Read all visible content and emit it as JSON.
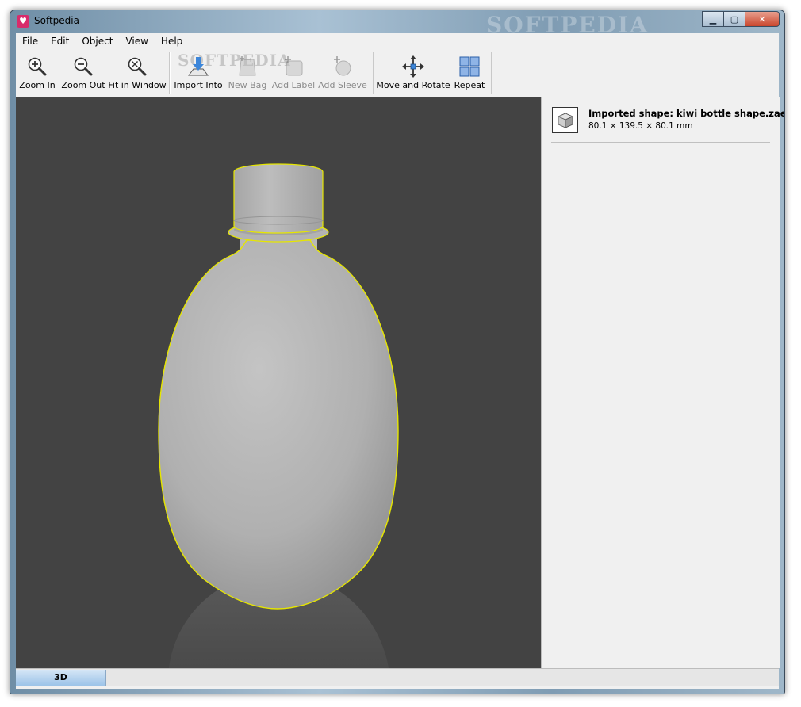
{
  "window": {
    "title": "Softpedia",
    "title_watermark": "SOFTPEDIA",
    "minimize_label": "▁",
    "maximize_label": "▢",
    "close_label": "✕"
  },
  "menu": {
    "items": [
      "File",
      "Edit",
      "Object",
      "View",
      "Help"
    ]
  },
  "toolbar": {
    "watermark": "SOFTPEDIA",
    "buttons": [
      {
        "label": "Zoom In",
        "icon": "zoom-in-icon",
        "enabled": true
      },
      {
        "label": "Zoom Out",
        "icon": "zoom-out-icon",
        "enabled": true
      },
      {
        "label": "Fit in Window",
        "icon": "fit-window-icon",
        "enabled": true
      },
      {
        "label": "Import Into",
        "icon": "import-icon",
        "enabled": true
      },
      {
        "label": "New Bag",
        "icon": "new-bag-icon",
        "enabled": false
      },
      {
        "label": "Add Label",
        "icon": "add-label-icon",
        "enabled": false
      },
      {
        "label": "Add Sleeve",
        "icon": "add-sleeve-icon",
        "enabled": false
      },
      {
        "label": "Move and Rotate",
        "icon": "move-rotate-icon",
        "enabled": true
      },
      {
        "label": "Repeat",
        "icon": "repeat-icon",
        "enabled": true
      }
    ]
  },
  "panel": {
    "shape_title": "Imported shape: kiwi bottle shape.zae",
    "shape_dims": "80.1 × 139.5 × 80.1 mm"
  },
  "status": {
    "tab_label": "3D"
  },
  "colors": {
    "viewport_bg": "#434343",
    "selection_outline": "#e6e600",
    "bottle_fill": "#b4b4b4"
  }
}
